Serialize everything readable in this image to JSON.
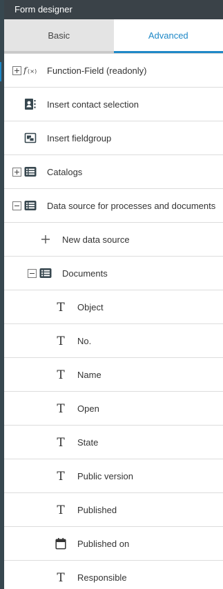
{
  "header": {
    "title": "Form designer"
  },
  "tabs": {
    "basic": "Basic",
    "advanced": "Advanced"
  },
  "items": [
    {
      "label": "Function-Field (readonly)",
      "icon": "function-icon",
      "expander": "plus",
      "level": 0
    },
    {
      "label": "Insert contact selection",
      "icon": "contact-card-icon",
      "expander": null,
      "level": 0
    },
    {
      "label": "Insert fieldgroup",
      "icon": "fieldgroup-icon",
      "expander": null,
      "level": 0
    },
    {
      "label": "Catalogs",
      "icon": "list-icon",
      "expander": "plus",
      "level": 0
    },
    {
      "label": "Data source for processes and documents",
      "icon": "list-icon",
      "expander": "minus",
      "level": 0
    },
    {
      "label": "New data source",
      "icon": "plus-icon",
      "expander": null,
      "level": 1
    },
    {
      "label": "Documents",
      "icon": "list-icon",
      "expander": "minus",
      "level": 1
    },
    {
      "label": "Object",
      "icon": "text-field-icon",
      "level": 2
    },
    {
      "label": "No.",
      "icon": "text-field-icon",
      "level": 2
    },
    {
      "label": "Name",
      "icon": "text-field-icon",
      "level": 2
    },
    {
      "label": "Open",
      "icon": "text-field-icon",
      "level": 2
    },
    {
      "label": "State",
      "icon": "text-field-icon",
      "level": 2
    },
    {
      "label": "Public version",
      "icon": "text-field-icon",
      "level": 2
    },
    {
      "label": "Published",
      "icon": "text-field-icon",
      "level": 2
    },
    {
      "label": "Published on",
      "icon": "calendar-icon",
      "level": 2
    },
    {
      "label": "Responsible",
      "icon": "text-field-icon",
      "level": 2
    }
  ],
  "colors": {
    "accent": "#1e88c7",
    "titlebar": "#3a4248",
    "divider": "#dcdcdc"
  }
}
